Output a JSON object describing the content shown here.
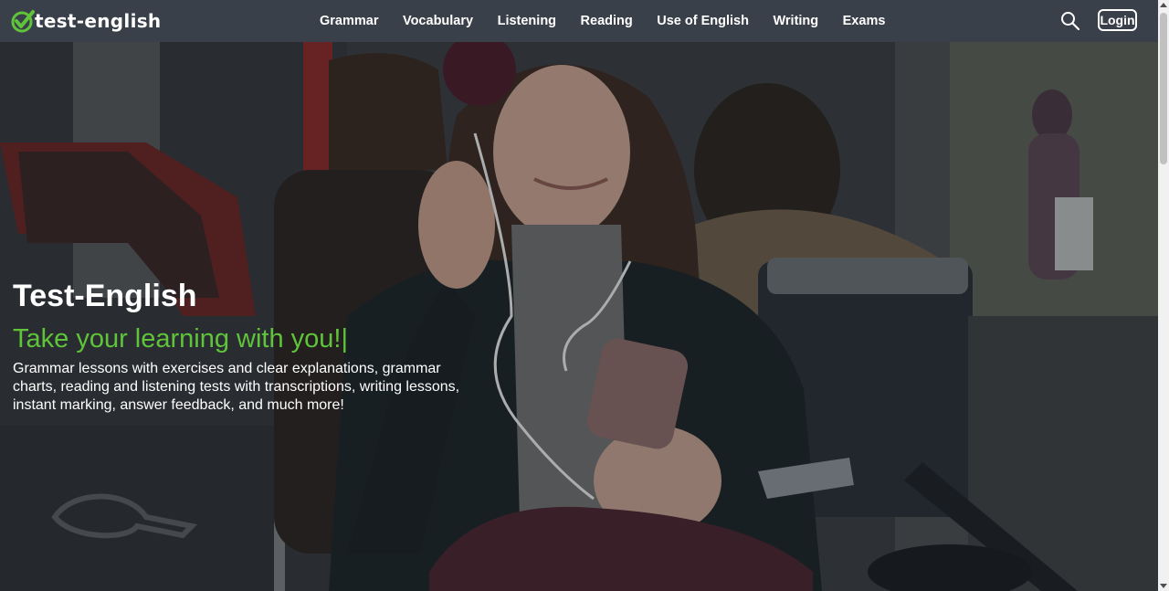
{
  "brand": {
    "name": "test-english",
    "accent_color": "#5fc43a",
    "icon": "check-circle-icon"
  },
  "nav": {
    "items": [
      {
        "label": "Grammar"
      },
      {
        "label": "Vocabulary"
      },
      {
        "label": "Listening"
      },
      {
        "label": "Reading"
      },
      {
        "label": "Use of English"
      },
      {
        "label": "Writing"
      },
      {
        "label": "Exams"
      }
    ]
  },
  "header": {
    "search_icon": "search-icon",
    "login_label": "Login",
    "background": "#3a4049"
  },
  "hero": {
    "title": "Test-English",
    "tagline": "Take your learning with you!",
    "cursor": "|",
    "description": "Grammar lessons with exercises and clear explanations, grammar charts, reading and listening tests with transcriptions, writing lessons, instant marking, answer feedback, and much more!"
  }
}
